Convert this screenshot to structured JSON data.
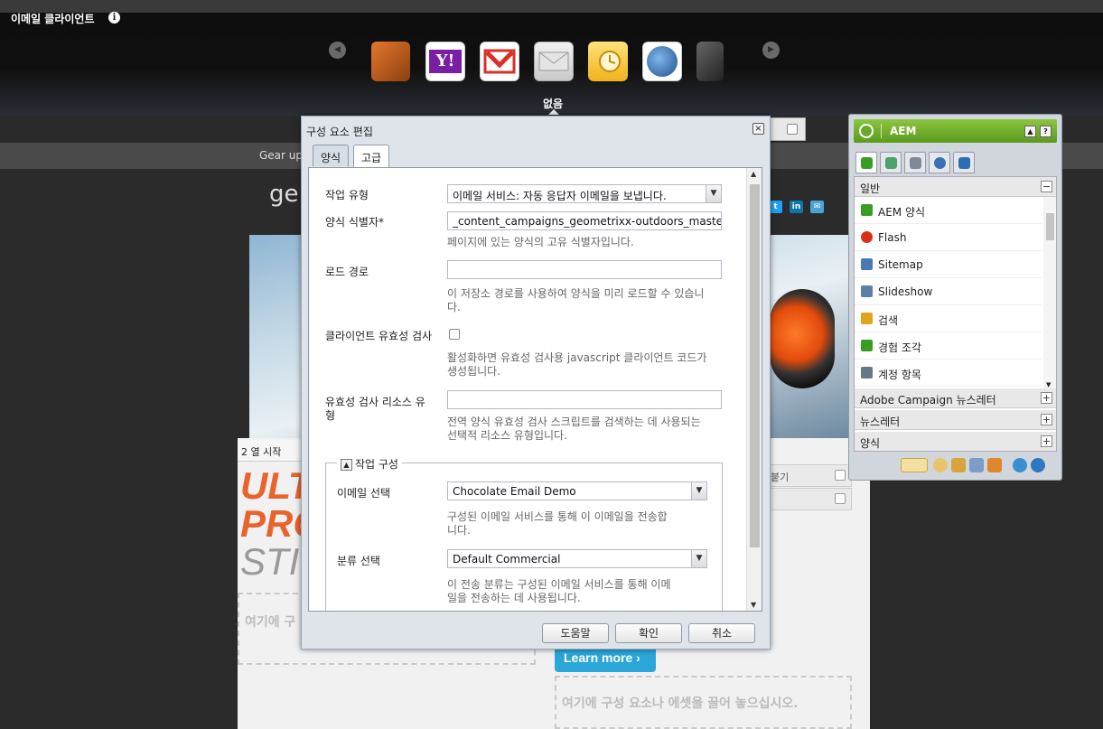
{
  "top": {
    "title": "이메일 클라이언트",
    "info_icon": "info-icon",
    "selected_client_label": "없음",
    "clients": [
      {
        "name": "partial-client-left",
        "color": "#e6772c"
      },
      {
        "name": "yahoo-icon",
        "color": "#7b1fa2"
      },
      {
        "name": "gmail-icon",
        "color": "#d93025"
      },
      {
        "name": "generic-mail-icon",
        "color": "#cfcfcf"
      },
      {
        "name": "outlook-icon",
        "color": "#f4c430"
      },
      {
        "name": "thunderbird-icon",
        "color": "#2b6cb0"
      },
      {
        "name": "partial-client-right",
        "color": "#555555"
      }
    ]
  },
  "page": {
    "gear_text": "Gear up",
    "brand": "ge",
    "column_start": "2 열 시작",
    "ultra_lines": [
      "ULT",
      "PRO",
      "STI"
    ],
    "drop_left": "여기에 구",
    "drop_right": "여기에 구성 요소나 에셋을 끌어 놓으십시오.",
    "learn_more": "Learn more ›",
    "side_row_text": "붙기"
  },
  "dialog": {
    "title": "구성 요소 편집",
    "close_symbol": "×",
    "tabs": [
      "양식",
      "고급"
    ],
    "active_tab": 1,
    "fields": {
      "action_type_label": "작업 유형",
      "action_type_value": "이메일 서비스: 자동 응답자 이메일을 보냅니다.",
      "form_id_label": "양식 식별자*",
      "form_id_value": "_content_campaigns_geometrixx-outdoors_master_e-m",
      "form_id_hint": "페이지에 있는 양식의 고유 식별자입니다.",
      "load_path_label": "로드 경로",
      "load_path_value": "",
      "load_path_hint_1": "이 저장소 경로를 사용하여 양식을 미리 로드할 수 있습니",
      "load_path_hint_2": "다.",
      "client_validation_label": "클라이언트 유효성 검사",
      "client_validation_hint_1": "활성화하면 유효성 검사용 javascript 클라이언트 코드가",
      "client_validation_hint_2": "생성됩니다.",
      "validation_rt_label_1": "유효성 검사 리소스 유",
      "validation_rt_label_2": "형",
      "validation_rt_value": "",
      "validation_rt_hint_1": "전역 양식 유효성 검사 스크립트를 검색하는 데 사용되는",
      "validation_rt_hint_2": "선택적 리소스 유형입니다."
    },
    "fieldset": {
      "legend": "작업 구성",
      "email_label": "이메일 선택",
      "email_value": "Chocolate Email Demo",
      "email_hint_1": "구성된 이메일 서비스를 통해 이 이메일을 전송합",
      "email_hint_2": "니다.",
      "classification_label": "분류 선택",
      "classification_value": "Default Commercial",
      "classification_hint_1": "이 전송 분류는 구성된 이메일 서비스를 통해 이메",
      "classification_hint_2": "일을 전송하는 데 사용됩니다."
    },
    "buttons": {
      "help": "도움말",
      "ok": "확인",
      "cancel": "취소"
    }
  },
  "sidekick": {
    "title": "AEM",
    "help_symbol": "?",
    "sections": {
      "general": "일반",
      "adobe_campaign": "Adobe Campaign 뉴스레터",
      "newsletter": "뉴스레터",
      "form": "양식"
    },
    "collapse_symbol": "−",
    "expand_symbol": "+",
    "items": [
      {
        "label": "AEM 양식",
        "icon": "components-icon",
        "color": "#3a9d23"
      },
      {
        "label": "Flash",
        "icon": "flash-icon",
        "color": "#d9301c"
      },
      {
        "label": "Sitemap",
        "icon": "sitemap-icon",
        "color": "#4a78b5"
      },
      {
        "label": "Slideshow",
        "icon": "slideshow-icon",
        "color": "#5b7fa6"
      },
      {
        "label": "검색",
        "icon": "search-component-icon",
        "color": "#e0a41c"
      },
      {
        "label": "경험 조각",
        "icon": "experience-fragment-icon",
        "color": "#3a9d23"
      },
      {
        "label": "계정 항목",
        "icon": "account-item-icon",
        "color": "#667788"
      }
    ],
    "accent_color": "#6aa82a"
  }
}
